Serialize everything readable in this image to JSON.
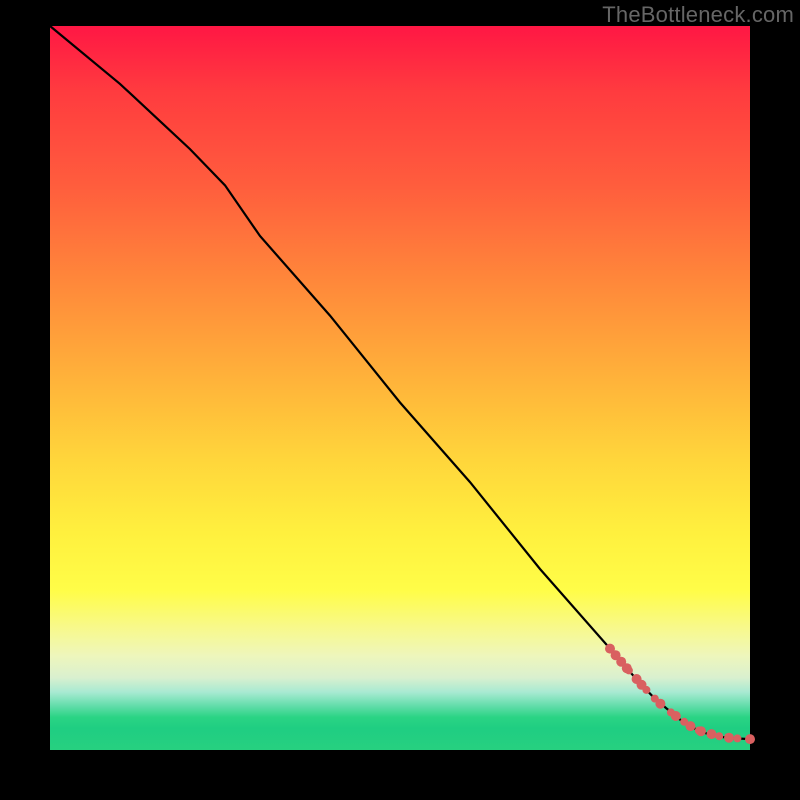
{
  "watermark": "TheBottleneck.com",
  "chart_data": {
    "type": "line",
    "title": "",
    "xlabel": "",
    "ylabel": "",
    "xlim": [
      0,
      100
    ],
    "ylim": [
      0,
      100
    ],
    "grid": false,
    "legend": false,
    "background_gradient": "red-to-green vertical heatmap",
    "series": [
      {
        "name": "curve",
        "style": "black-line",
        "x": [
          0,
          10,
          20,
          25,
          30,
          40,
          50,
          60,
          70,
          80,
          84,
          86,
          88,
          90,
          92,
          94,
          96,
          98,
          100
        ],
        "y": [
          100,
          92,
          83,
          78,
          71,
          60,
          48,
          37,
          25,
          14,
          9.5,
          7.5,
          5.8,
          4.2,
          3.0,
          2.2,
          1.8,
          1.6,
          1.5
        ]
      },
      {
        "name": "dots-lower-tail",
        "style": "salmon-dots",
        "points": [
          {
            "x": 80.0,
            "y": 14.0,
            "r": 5
          },
          {
            "x": 80.8,
            "y": 13.1,
            "r": 5
          },
          {
            "x": 81.6,
            "y": 12.2,
            "r": 5
          },
          {
            "x": 82.4,
            "y": 11.3,
            "r": 5
          },
          {
            "x": 82.7,
            "y": 11.0,
            "r": 4
          },
          {
            "x": 83.8,
            "y": 9.8,
            "r": 5
          },
          {
            "x": 84.5,
            "y": 9.0,
            "r": 5
          },
          {
            "x": 85.2,
            "y": 8.3,
            "r": 4
          },
          {
            "x": 86.4,
            "y": 7.1,
            "r": 4
          },
          {
            "x": 87.2,
            "y": 6.4,
            "r": 5
          },
          {
            "x": 88.7,
            "y": 5.2,
            "r": 4
          },
          {
            "x": 89.4,
            "y": 4.7,
            "r": 5
          },
          {
            "x": 90.6,
            "y": 3.9,
            "r": 4
          },
          {
            "x": 91.5,
            "y": 3.3,
            "r": 5
          },
          {
            "x": 92.7,
            "y": 2.7,
            "r": 4
          },
          {
            "x": 93.0,
            "y": 2.6,
            "r": 5
          },
          {
            "x": 94.5,
            "y": 2.2,
            "r": 5
          },
          {
            "x": 95.6,
            "y": 1.9,
            "r": 4
          },
          {
            "x": 97.0,
            "y": 1.7,
            "r": 5
          },
          {
            "x": 98.2,
            "y": 1.6,
            "r": 4
          },
          {
            "x": 100.0,
            "y": 1.5,
            "r": 5
          }
        ]
      }
    ],
    "colors": {
      "line": "#000000",
      "dots": "#d96060"
    }
  }
}
